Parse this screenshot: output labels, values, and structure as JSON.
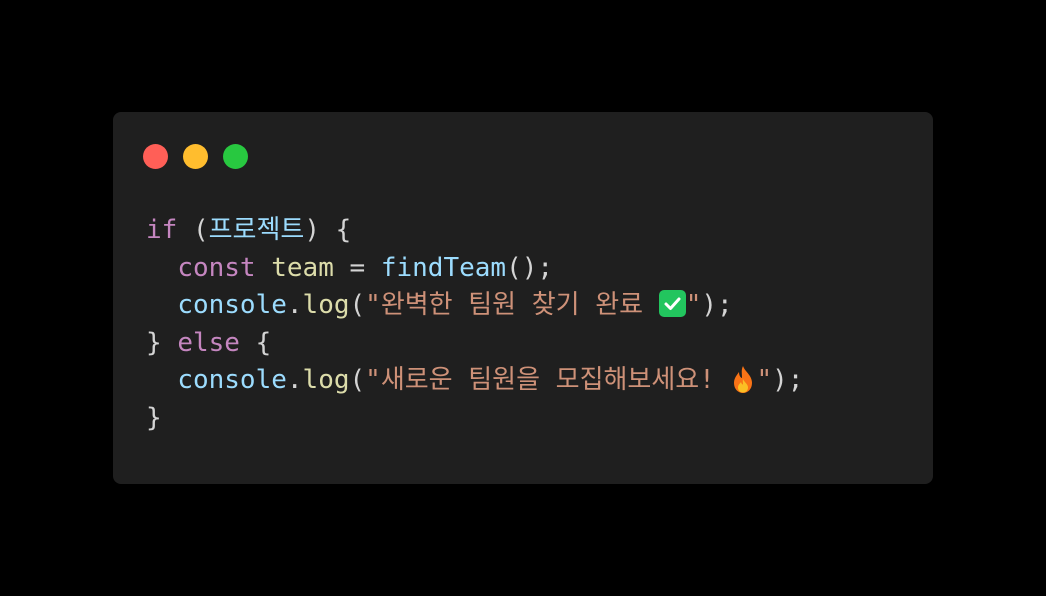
{
  "window": {
    "controls": [
      {
        "name": "close",
        "color": "#ff5f57"
      },
      {
        "name": "minimize",
        "color": "#ffbd2e"
      },
      {
        "name": "maximize",
        "color": "#28c840"
      }
    ]
  },
  "code": {
    "line1": {
      "keyword": "if",
      "open": " (",
      "condition": "프로젝트",
      "close": ") {"
    },
    "line2": {
      "indent": "  ",
      "keyword": "const",
      "variable": "team",
      "assign": " = ",
      "function": "findTeam",
      "end": "();"
    },
    "line3": {
      "indent": "  ",
      "object": "console",
      "dot": ".",
      "method": "log",
      "open": "(",
      "string": "\"완벽한 팀원 찾기 완료 ",
      "string_end": "\"",
      "end": ");"
    },
    "line4": {
      "close": "} ",
      "keyword": "else",
      "open": " {"
    },
    "line5": {
      "indent": "  ",
      "object": "console",
      "dot": ".",
      "method": "log",
      "open": "(",
      "string": "\"새로운 팀원을 모집해보세요! ",
      "string_end": "\"",
      "end": ");"
    },
    "line6": {
      "close": "}"
    }
  },
  "emoji": {
    "check": {
      "icon": "check-mark-button-icon",
      "color": "#22c55e"
    },
    "fire": {
      "icon": "fire-icon",
      "color": "#f97316"
    }
  }
}
